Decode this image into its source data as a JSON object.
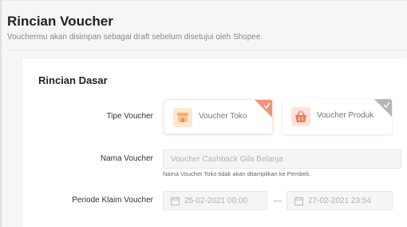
{
  "header": {
    "title": "Rincian Voucher",
    "subtitle": "Vouchermu akan disimpan sebagai draft sebelum disetujui oleh Shopee."
  },
  "section": {
    "title": "Rincian Dasar"
  },
  "form": {
    "voucher_type_label": "Tipe Voucher",
    "voucher_types": [
      {
        "label": "Voucher Toko",
        "icon": "shop-icon",
        "selected": true,
        "corner_color": "#f1947a"
      },
      {
        "label": "Voucher Produk",
        "icon": "basket-icon",
        "selected": false,
        "corner_color": "#b5b5b5"
      }
    ],
    "voucher_name_label": "Nama Voucher",
    "voucher_name_placeholder": "Voucher Cashback Gila Belanja",
    "voucher_name_hint": "Nama Voucher Toko tidak akan ditampilkan ke Pembeli.",
    "claim_period_label": "Periode Klaim Voucher",
    "claim_start": "25-02-2021 00:00",
    "claim_end": "27-02-2021 23:54"
  },
  "colors": {
    "accent": "#ee4d2d",
    "accent_light": "#fde3d9",
    "icon_orange": "#f6b26b"
  }
}
